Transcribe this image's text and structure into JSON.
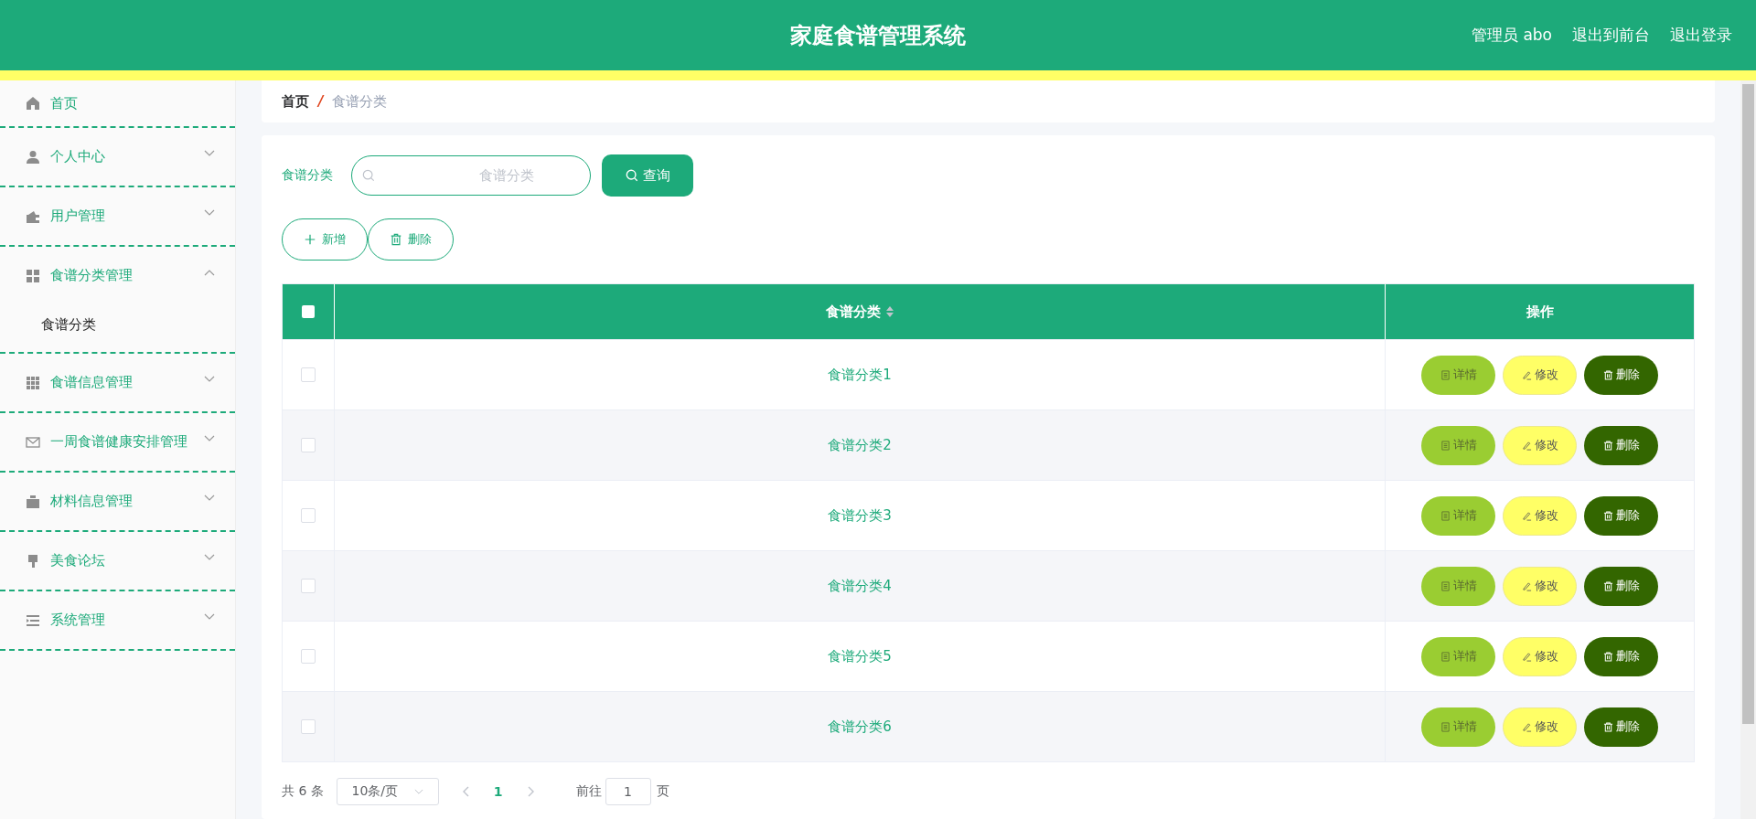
{
  "header": {
    "title": "家庭食谱管理系统",
    "user": "管理员 abo",
    "links": [
      "退出到前台",
      "退出登录"
    ]
  },
  "sidebar": {
    "items": [
      {
        "label": "首页",
        "kind": "link"
      },
      {
        "label": "个人中心",
        "kind": "menu",
        "expanded": false
      },
      {
        "label": "用户管理",
        "kind": "menu",
        "expanded": false
      },
      {
        "label": "食谱分类管理",
        "kind": "menu",
        "expanded": true,
        "children": [
          {
            "label": "食谱分类"
          }
        ]
      },
      {
        "label": "食谱信息管理",
        "kind": "menu",
        "expanded": false
      },
      {
        "label": "一周食谱健康安排管理",
        "kind": "menu",
        "expanded": false
      },
      {
        "label": "材料信息管理",
        "kind": "menu",
        "expanded": false
      },
      {
        "label": "美食论坛",
        "kind": "menu",
        "expanded": false
      },
      {
        "label": "系统管理",
        "kind": "menu",
        "expanded": false
      }
    ]
  },
  "breadcrumb": {
    "items": [
      "首页",
      "食谱分类"
    ],
    "separator": "/"
  },
  "search": {
    "label": "食谱分类",
    "placeholder": "食谱分类",
    "button": "查询"
  },
  "toolbar": [
    {
      "label": "新增",
      "kind": "add"
    },
    {
      "label": "删除",
      "kind": "delete"
    }
  ],
  "table": {
    "select_all": {
      "checked": false
    },
    "columns": [
      "食谱分类",
      "操作"
    ],
    "rows": [
      {
        "checked": false,
        "name": "食谱分类1",
        "actions": [
          {
            "label": "详情",
            "kind": "detail"
          },
          {
            "label": "修改",
            "kind": "edit"
          },
          {
            "label": "删除",
            "kind": "delete"
          }
        ]
      },
      {
        "checked": false,
        "name": "食谱分类2",
        "actions": [
          {
            "label": "详情",
            "kind": "detail"
          },
          {
            "label": "修改",
            "kind": "edit"
          },
          {
            "label": "删除",
            "kind": "delete"
          }
        ]
      },
      {
        "checked": false,
        "name": "食谱分类3",
        "actions": [
          {
            "label": "详情",
            "kind": "detail"
          },
          {
            "label": "修改",
            "kind": "edit"
          },
          {
            "label": "删除",
            "kind": "delete"
          }
        ]
      },
      {
        "checked": false,
        "name": "食谱分类4",
        "actions": [
          {
            "label": "详情",
            "kind": "detail"
          },
          {
            "label": "修改",
            "kind": "edit"
          },
          {
            "label": "删除",
            "kind": "delete"
          }
        ]
      },
      {
        "checked": false,
        "name": "食谱分类5",
        "actions": [
          {
            "label": "详情",
            "kind": "detail"
          },
          {
            "label": "修改",
            "kind": "edit"
          },
          {
            "label": "删除",
            "kind": "delete"
          }
        ]
      },
      {
        "checked": false,
        "name": "食谱分类6",
        "actions": [
          {
            "label": "详情",
            "kind": "detail"
          },
          {
            "label": "修改",
            "kind": "edit"
          },
          {
            "label": "删除",
            "kind": "delete"
          }
        ]
      }
    ]
  },
  "pagination": {
    "total": "共 6 条",
    "page_size": "10条/页",
    "pages": [
      {
        "label": "1",
        "selected": true
      }
    ],
    "goto_label": "前往",
    "goto_value": "1",
    "goto_suffix": "页"
  }
}
